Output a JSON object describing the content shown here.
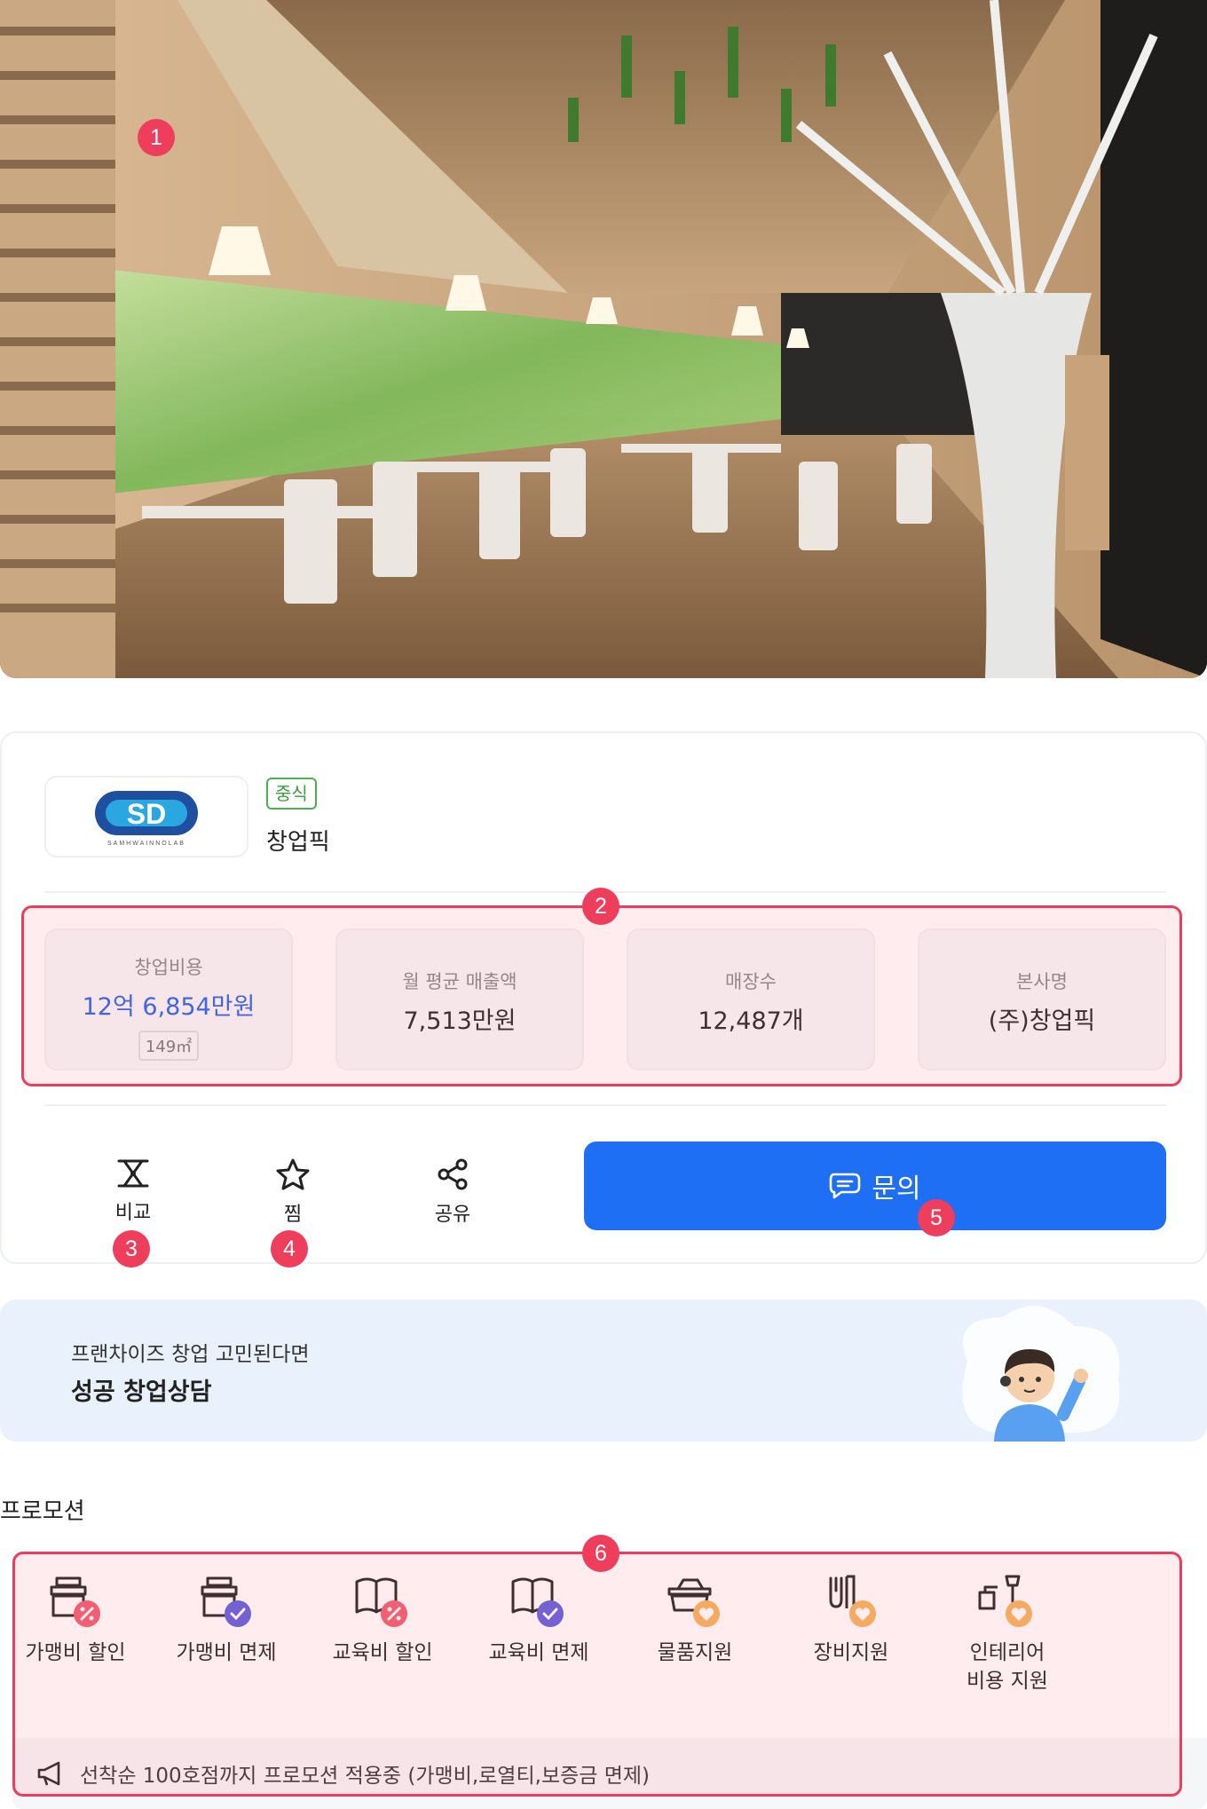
{
  "markers": [
    "1",
    "2",
    "3",
    "4",
    "5",
    "6"
  ],
  "brand": {
    "logo_text": "SD",
    "logo_tagline": "SAMHWAINNOLAB",
    "category_badge": "중식",
    "name": "창업픽"
  },
  "stats": [
    {
      "label": "창업비용",
      "value": "12억 6,854만원",
      "sub": "149㎡",
      "accent": "#2563eb"
    },
    {
      "label": "월 평균 매출액",
      "value": "7,513만원"
    },
    {
      "label": "매장수",
      "value": "12,487개"
    },
    {
      "label": "본사명",
      "value": "(주)창업픽"
    }
  ],
  "actions": {
    "compare": {
      "label": "비교",
      "icon": "compare-icon"
    },
    "favorite": {
      "label": "찜",
      "icon": "star-icon"
    },
    "share": {
      "label": "공유",
      "icon": "share-icon"
    },
    "inquiry": {
      "label": "문의",
      "icon": "chat-icon",
      "color": "#1f6ff5"
    }
  },
  "banner": {
    "subtitle": "프랜차이즈 창업 고민된다면",
    "title": "성공 창업상담"
  },
  "promotions": {
    "title": "프로모션",
    "items": [
      {
        "label": "가맹비 할인",
        "icon": "franchise-discount-icon"
      },
      {
        "label": "가맹비 면제",
        "icon": "franchise-exempt-icon"
      },
      {
        "label": "교육비 할인",
        "icon": "education-discount-icon"
      },
      {
        "label": "교육비 면제",
        "icon": "education-exempt-icon"
      },
      {
        "label": "물품지원",
        "icon": "goods-support-icon"
      },
      {
        "label": "장비지원",
        "icon": "equipment-support-icon"
      },
      {
        "label_line1": "인테리어",
        "label_line2": "비용 지원",
        "icon": "interior-support-icon"
      }
    ],
    "notice": "선착순 100호점까지 프로모션 적용중 (가맹비,로열티,보증금 면제)"
  }
}
